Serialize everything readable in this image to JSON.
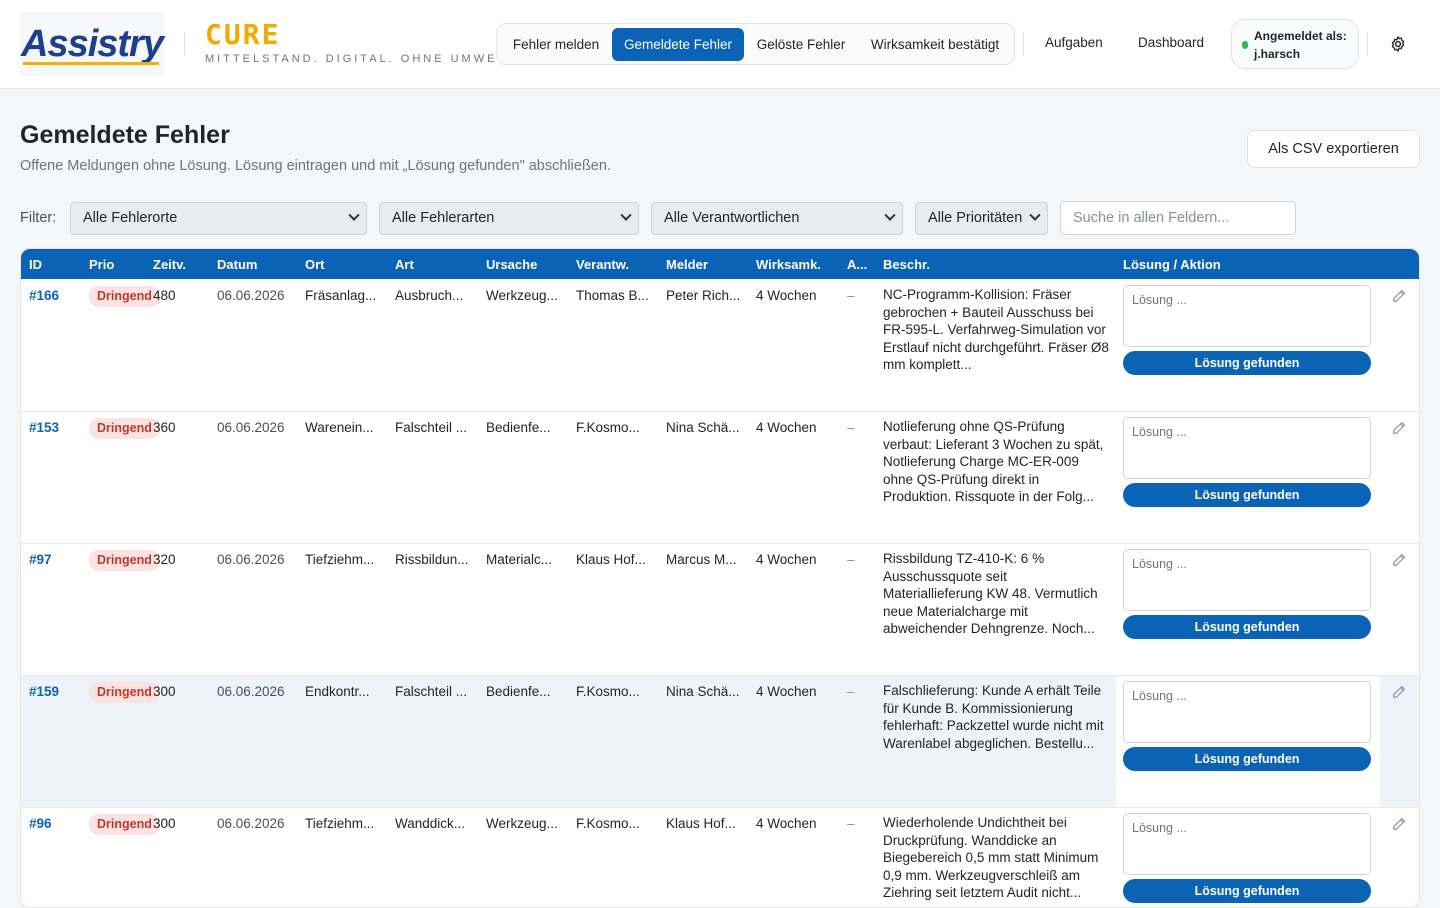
{
  "header": {
    "logo": "Assistry",
    "brand_title": "CURE",
    "brand_subtitle": "MITTELSTAND. DIGITAL. OHNE UMWEGE.",
    "nav_tabs": [
      {
        "label": "Fehler melden",
        "active": false
      },
      {
        "label": "Gemeldete Fehler",
        "active": true
      },
      {
        "label": "Gelöste Fehler",
        "active": false
      },
      {
        "label": "Wirksamkeit bestätigt",
        "active": false
      }
    ],
    "links": [
      "Aufgaben",
      "Dashboard"
    ],
    "user_label": "Angemeldet als:",
    "user_name": "j.harsch",
    "settings_icon": "gear-icon"
  },
  "page": {
    "title": "Gemeldete Fehler",
    "subtitle": "Offene Meldungen ohne Lösung. Lösung eintragen und mit „Lösung gefunden\" abschließen.",
    "export_button": "Als CSV exportieren"
  },
  "filters": {
    "label": "Filter:",
    "selects": [
      "Alle Fehlerorte",
      "Alle Fehlerarten",
      "Alle Verantwortlichen",
      "Alle Prioritäten"
    ],
    "search_placeholder": "Suche in allen Feldern..."
  },
  "table": {
    "columns": [
      "ID",
      "Prio",
      "Zeitv.",
      "Datum",
      "Ort",
      "Art",
      "Ursache",
      "Verantw.",
      "Melder",
      "Wirksamk.",
      "A...",
      "Beschr.",
      "Lösung / Aktion"
    ],
    "solution_placeholder": "Lösung ...",
    "solution_button": "Lösung gefunden",
    "rows": [
      {
        "id": "#166",
        "prio": "Dringend",
        "zeitv": "480",
        "datum": "06.06.2026",
        "ort": "Fräsanlag...",
        "art": "Ausbruch...",
        "ursache": "Werkzeug...",
        "verantw": "Thomas B...",
        "melder": "Peter Rich...",
        "wirksamk": "4 Wochen",
        "a": "–",
        "beschr": "NC-Programm-Kollision: Fräser gebrochen + Bauteil Ausschuss bei FR-595-L. Verfahrweg-Simulation vor Erstlauf nicht durchgeführt. Fräser Ø8 mm komplett..."
      },
      {
        "id": "#153",
        "prio": "Dringend",
        "zeitv": "360",
        "datum": "06.06.2026",
        "ort": "Warenein...",
        "art": "Falschteil ...",
        "ursache": "Bedienfe...",
        "verantw": "F.Kosmo...",
        "melder": "Nina Schä...",
        "wirksamk": "4 Wochen",
        "a": "–",
        "beschr": "Notlieferung ohne QS-Prüfung verbaut: Lieferant 3 Wochen zu spät, Notlieferung Charge MC-ER-009 ohne QS-Prüfung direkt in Produktion. Rissquote in der Folg..."
      },
      {
        "id": "#97",
        "prio": "Dringend",
        "zeitv": "320",
        "datum": "06.06.2026",
        "ort": "Tiefziehm...",
        "art": "Rissbildun...",
        "ursache": "Materialc...",
        "verantw": "Klaus Hof...",
        "melder": "Marcus M...",
        "wirksamk": "4 Wochen",
        "a": "–",
        "beschr": "Rissbildung TZ-410-K: 6 % Ausschussquote seit Materiallieferung KW 48. Vermutlich neue Materialcharge mit abweichender Dehngrenze. Noch..."
      },
      {
        "id": "#159",
        "prio": "Dringend",
        "zeitv": "300",
        "datum": "06.06.2026",
        "ort": "Endkontr...",
        "art": "Falschteil ...",
        "ursache": "Bedienfe...",
        "verantw": "F.Kosmo...",
        "melder": "Nina Schä...",
        "wirksamk": "4 Wochen",
        "a": "–",
        "beschr": "Falschlieferung: Kunde A erhält Teile für Kunde B. Kommissionierung fehlerhaft: Packzettel wurde nicht mit Warenlabel abgeglichen. Bestellu..."
      },
      {
        "id": "#96",
        "prio": "Dringend",
        "zeitv": "300",
        "datum": "06.06.2026",
        "ort": "Tiefziehm...",
        "art": "Wanddick...",
        "ursache": "Werkzeug...",
        "verantw": "F.Kosmo...",
        "melder": "Klaus Hof...",
        "wirksamk": "4 Wochen",
        "a": "–",
        "beschr": "Wiederholende Undichtheit bei Druckprüfung. Wanddicke an Biegebereich 0,5 mm statt Minimum 0,9 mm. Werkzeugverschleiß am Ziehring seit letztem Audit nicht..."
      }
    ]
  },
  "colors": {
    "primary": "#0b63b5",
    "brand_yellow": "#f2a900",
    "badge_bg": "#fde2e2",
    "badge_text": "#c0392b"
  }
}
